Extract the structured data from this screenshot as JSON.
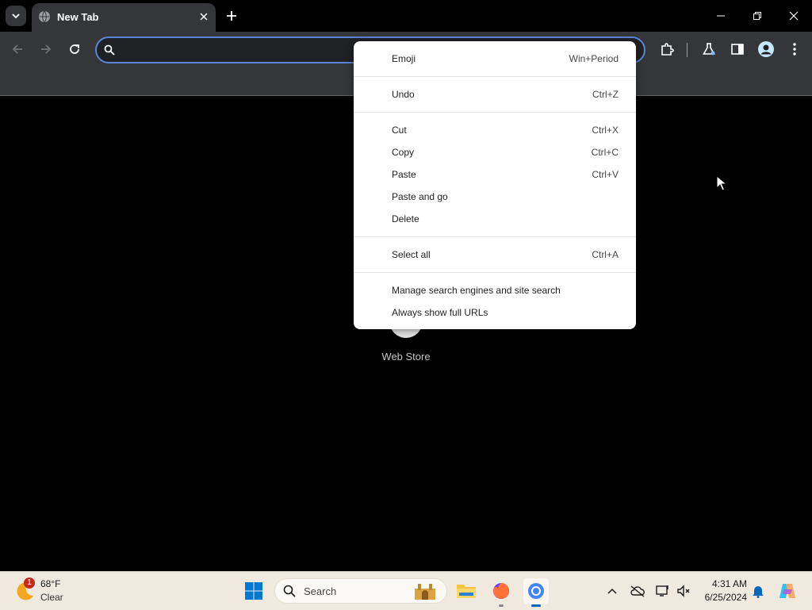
{
  "browser": {
    "tab": {
      "title": "New Tab"
    },
    "omnibox": {
      "value": "",
      "placeholder": ""
    }
  },
  "ntp": {
    "shortcut_label": "Web Store"
  },
  "context_menu": {
    "emoji": {
      "label": "Emoji",
      "shortcut": "Win+Period"
    },
    "undo": {
      "label": "Undo",
      "shortcut": "Ctrl+Z"
    },
    "cut": {
      "label": "Cut",
      "shortcut": "Ctrl+X"
    },
    "copy": {
      "label": "Copy",
      "shortcut": "Ctrl+C"
    },
    "paste": {
      "label": "Paste",
      "shortcut": "Ctrl+V"
    },
    "paste_and_go": {
      "label": "Paste and go"
    },
    "delete": {
      "label": "Delete"
    },
    "select_all": {
      "label": "Select all",
      "shortcut": "Ctrl+A"
    },
    "manage_search": {
      "label": "Manage search engines and site search"
    },
    "always_full_urls": {
      "label": "Always show full URLs"
    }
  },
  "taskbar": {
    "weather": {
      "badge": "1",
      "temperature": "68°F",
      "condition": "Clear"
    },
    "search": {
      "label": "Search"
    },
    "clock": {
      "time": "4:31 AM",
      "date": "6/25/2024"
    }
  },
  "colors": {
    "omnibox_focus_ring": "#5b85d6",
    "toolbar": "#35363a",
    "taskbar": "#f0e9de",
    "accent": "#0067c0"
  }
}
